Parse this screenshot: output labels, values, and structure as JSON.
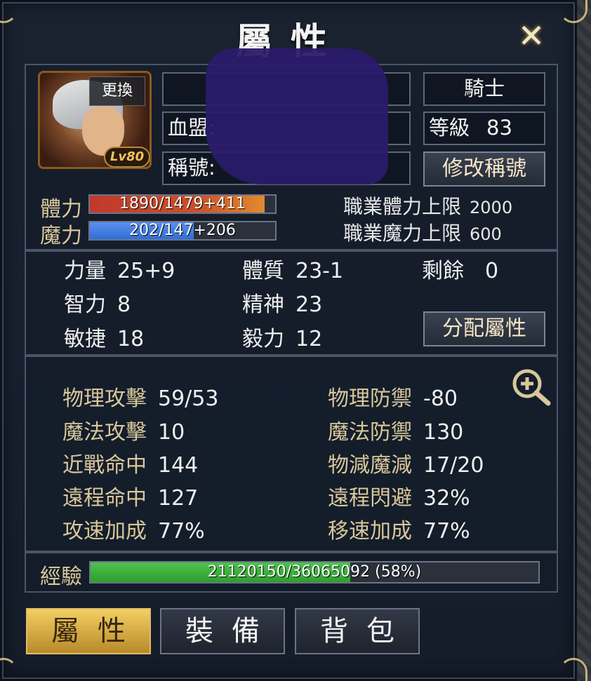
{
  "window": {
    "title": "屬性",
    "close_icon": "close-icon"
  },
  "profile": {
    "change_label": "更換",
    "level_badge": "Lv80",
    "name_value": "",
    "class_value": "騎士",
    "guild_label": "血盟:",
    "guild_value": "",
    "level_label": "等級",
    "level_value": "83",
    "title_label": "稱號:",
    "title_value": "",
    "edit_title_label": "修改稱號"
  },
  "vitals": {
    "hp_label": "體力",
    "hp_text": "1890/1479+411",
    "hp_fill": 0.945,
    "mp_label": "魔力",
    "mp_text": "202/147+206",
    "mp_fill": 0.56,
    "hp_limit_label": "職業體力上限",
    "hp_limit_value": "2000",
    "mp_limit_label": "職業魔力上限",
    "mp_limit_value": "600"
  },
  "base_stats": {
    "str_label": "力量",
    "str_value": "25+9",
    "con_label": "體質",
    "con_value": "23-1",
    "remain_label": "剩餘",
    "remain_value": "0",
    "int_label": "智力",
    "int_value": "8",
    "wis_label": "精神",
    "wis_value": "23",
    "dex_label": "敏捷",
    "dex_value": "18",
    "will_label": "毅力",
    "will_value": "12",
    "allocate_label": "分配屬性"
  },
  "combat_stats": {
    "phys_atk_label": "物理攻擊",
    "phys_atk_value": "59/53",
    "phys_def_label": "物理防禦",
    "phys_def_value": "-80",
    "mag_atk_label": "魔法攻擊",
    "mag_atk_value": "10",
    "mag_def_label": "魔法防禦",
    "mag_def_value": "130",
    "melee_hit_label": "近戰命中",
    "melee_hit_value": "144",
    "reduce_label": "物減魔減",
    "reduce_value": "17/20",
    "ranged_hit_label": "遠程命中",
    "ranged_hit_value": "127",
    "ranged_dodge_label": "遠程閃避",
    "ranged_dodge_value": "32%",
    "atk_speed_label": "攻速加成",
    "atk_speed_value": "77%",
    "move_speed_label": "移速加成",
    "move_speed_value": "77%",
    "zoom_icon": "zoom-in-icon"
  },
  "experience": {
    "label": "經驗",
    "text": "21120150/36065092 (58%)",
    "fill": 0.58
  },
  "tabs": [
    {
      "label": "屬性",
      "active": true
    },
    {
      "label": "裝備",
      "active": false
    },
    {
      "label": "背包",
      "active": false
    }
  ],
  "colors": {
    "hp_fill": "#c0392b",
    "mp_fill": "#2f6fd6",
    "exp_fill": "#2e9e2e",
    "accent_gold": "#d8c79a"
  }
}
